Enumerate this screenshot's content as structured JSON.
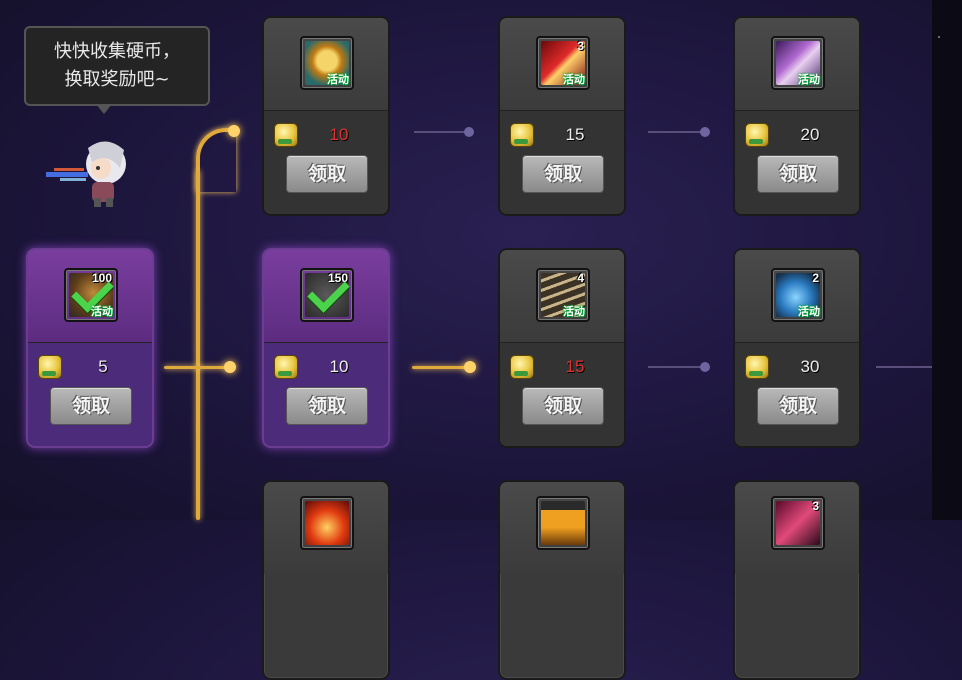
{
  "bubble": {
    "line1": "快快收集硬币，",
    "line2": "换取奖励吧~"
  },
  "button_label": "领取",
  "icon_tag": "活动",
  "cards": [
    {
      "id": "r1c1",
      "price": "10",
      "price_red": true,
      "count": "",
      "claimed": false,
      "icon": "gold-medal-icon"
    },
    {
      "id": "r1c2",
      "price": "15",
      "price_red": false,
      "count": "3",
      "claimed": false,
      "icon": "red-weapon-icon"
    },
    {
      "id": "r1c3",
      "price": "20",
      "price_red": false,
      "count": "",
      "claimed": false,
      "icon": "purple-box-icon"
    },
    {
      "id": "r2c0",
      "price": "5",
      "price_red": false,
      "count": "100",
      "claimed": true,
      "icon": "pet-icon"
    },
    {
      "id": "r2c1",
      "price": "10",
      "price_red": false,
      "count": "150",
      "claimed": true,
      "icon": "item-icon"
    },
    {
      "id": "r2c2",
      "price": "15",
      "price_red": true,
      "count": "4",
      "claimed": false,
      "icon": "fence-icon"
    },
    {
      "id": "r2c3",
      "price": "30",
      "price_red": false,
      "count": "2",
      "claimed": false,
      "icon": "blue-gem-icon"
    },
    {
      "id": "r3c1",
      "price": "",
      "price_red": false,
      "count": "",
      "claimed": false,
      "icon": "red-flame-icon"
    },
    {
      "id": "r3c2",
      "price": "",
      "price_red": false,
      "count": "",
      "claimed": false,
      "icon": "orange-pyramid-icon"
    },
    {
      "id": "r3c3",
      "price": "",
      "price_red": false,
      "count": "3",
      "claimed": false,
      "icon": "pink-weapon-icon"
    }
  ],
  "colors": {
    "gold_line": "#e0a93b",
    "purple_card": "#6b3d91",
    "red_price": "#e23030"
  }
}
